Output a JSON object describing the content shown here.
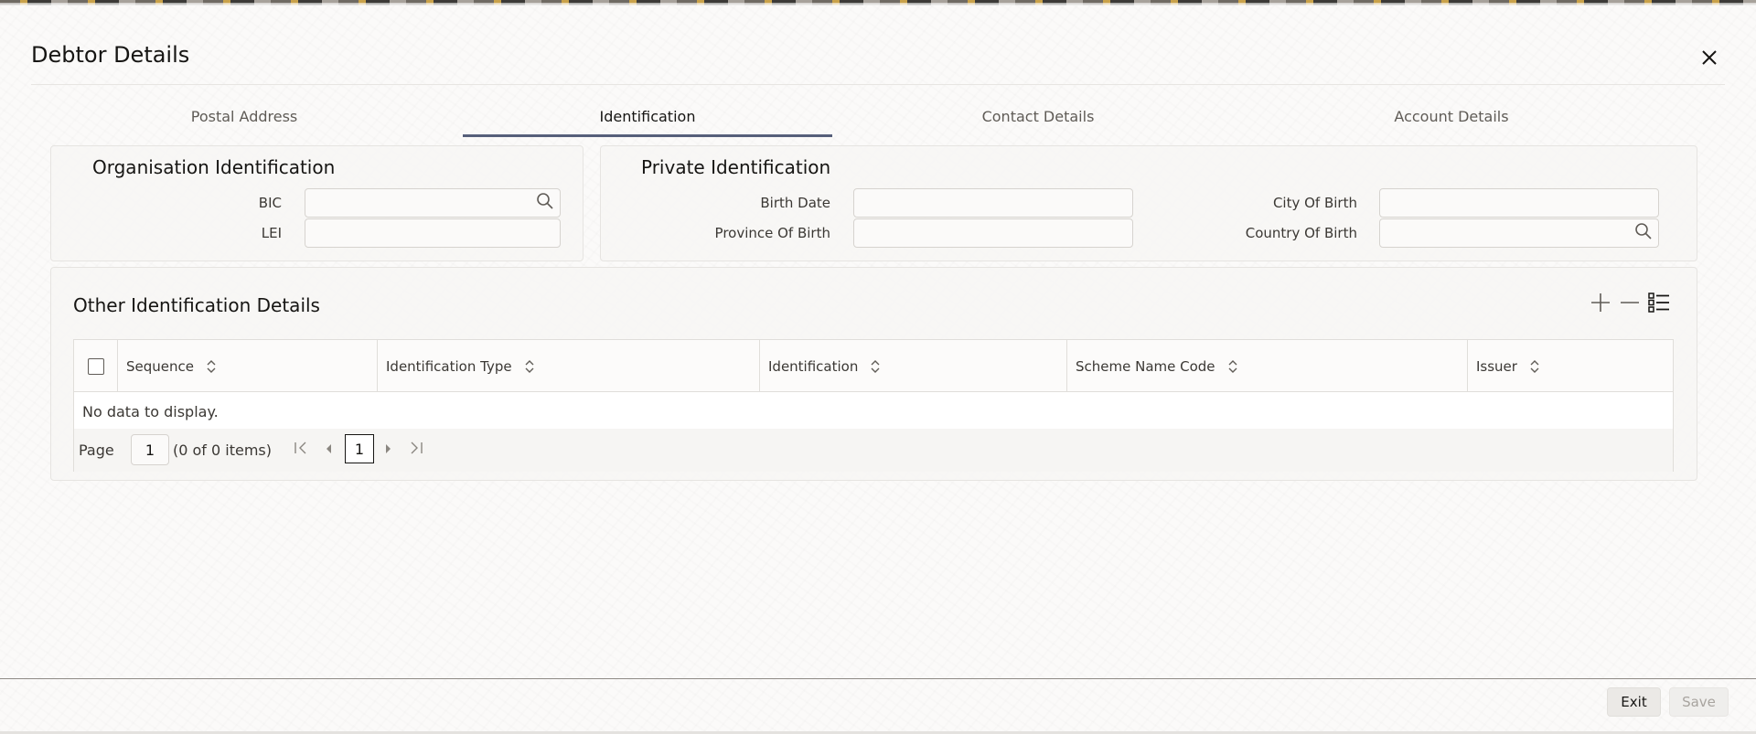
{
  "dialog": {
    "title": "Debtor Details",
    "close_icon": "close-icon"
  },
  "tabs": [
    {
      "label": "Postal Address",
      "active": false
    },
    {
      "label": "Identification",
      "active": true
    },
    {
      "label": "Contact Details",
      "active": false
    },
    {
      "label": "Account Details",
      "active": false
    }
  ],
  "organisation": {
    "title": "Organisation Identification",
    "bic_label": "BIC",
    "bic_value": "",
    "lei_label": "LEI",
    "lei_value": ""
  },
  "private": {
    "title": "Private Identification",
    "birth_date_label": "Birth Date",
    "birth_date_value": "",
    "province_label": "Province Of Birth",
    "province_value": "",
    "city_label": "City Of Birth",
    "city_value": "",
    "country_label": "Country Of Birth",
    "country_value": ""
  },
  "other": {
    "title": "Other Identification Details",
    "toolbar_icons": [
      "add-icon",
      "remove-icon",
      "column-list-icon"
    ],
    "columns": [
      "Sequence",
      "Identification Type",
      "Identification",
      "Scheme Name Code",
      "Issuer"
    ],
    "rows": [],
    "empty_text": "No data to display.",
    "pager": {
      "page_label": "Page",
      "page_value": "1",
      "summary": "(0 of 0 items)",
      "current_page": "1"
    }
  },
  "footer": {
    "exit_label": "Exit",
    "save_label": "Save"
  },
  "colors": {
    "accent_underline": "#565f7a",
    "text": "#161513",
    "disabled_text": "#a8a49f"
  }
}
